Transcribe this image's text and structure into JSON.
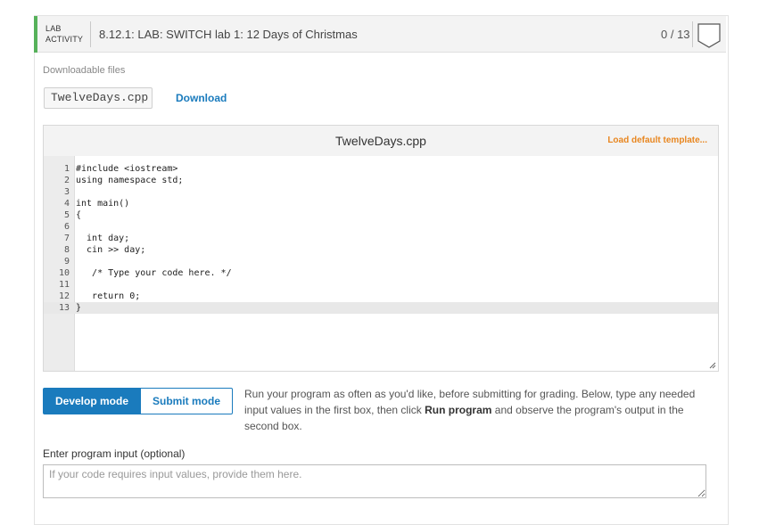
{
  "header": {
    "badge_line1": "LAB",
    "badge_line2": "ACTIVITY",
    "title": "8.12.1: LAB: SWITCH lab 1: 12 Days of Christmas",
    "score": "0 / 13",
    "accent": "#56b15a"
  },
  "downloads": {
    "label": "Downloadable files",
    "file_name": "TwelveDays.cpp",
    "download_label": "Download"
  },
  "editor": {
    "file_name": "TwelveDays.cpp",
    "load_template_label": "Load default template...",
    "active_line": 13,
    "lines": [
      "#include <iostream>",
      "using namespace std;",
      "",
      "int main()",
      "{",
      "",
      "  int day;",
      "  cin >> day;",
      "",
      "   /* Type your code here. */",
      "",
      "   return 0;",
      "}"
    ]
  },
  "modes": {
    "develop_label": "Develop mode",
    "submit_label": "Submit mode",
    "active": "develop"
  },
  "instructions": {
    "part1": "Run your program as often as you'd like, before submitting for grading. Below, type any needed input values in the first box, then click ",
    "bold": "Run program",
    "part2": " and observe the program's output in the second box."
  },
  "program_input": {
    "label": "Enter program input (optional)",
    "placeholder": "If your code requires input values, provide them here.",
    "value": ""
  },
  "colors": {
    "brand_blue": "#1a7bbd",
    "template_orange": "#e8861f"
  }
}
